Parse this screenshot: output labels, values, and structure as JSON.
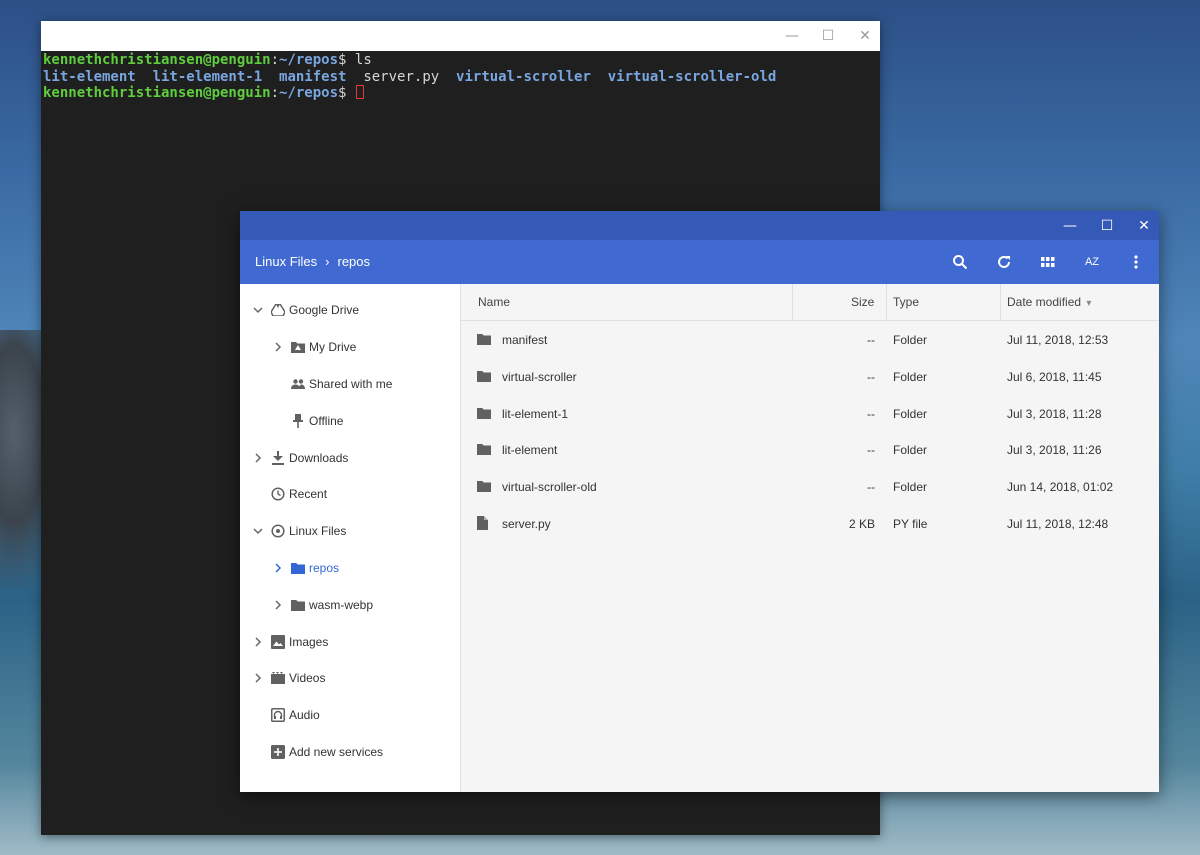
{
  "terminal": {
    "controls": {
      "minimize": "—",
      "maximize": "☐",
      "close": "✕"
    },
    "lines": [
      {
        "user": "kennethchristiansen@penguin",
        "sep": ":",
        "path": "~/repos",
        "prompt": "$ ",
        "cmd": "ls"
      },
      {
        "entries": [
          {
            "name": "lit-element",
            "kind": "dir"
          },
          {
            "name": "lit-element-1",
            "kind": "dir"
          },
          {
            "name": "manifest",
            "kind": "dir"
          },
          {
            "name": "server.py",
            "kind": "file"
          },
          {
            "name": "virtual-scroller",
            "kind": "dir"
          },
          {
            "name": "virtual-scroller-old",
            "kind": "dir"
          }
        ]
      },
      {
        "user": "kennethchristiansen@penguin",
        "sep": ":",
        "path": "~/repos",
        "prompt": "$ ",
        "cmd": ""
      }
    ]
  },
  "files": {
    "controls": {
      "minimize": "—",
      "maximize": "☐",
      "close": "✕"
    },
    "breadcrumb": {
      "root": "Linux Files",
      "separator": "›",
      "current": "repos"
    },
    "toolbar": {
      "search": "search-icon",
      "refresh": "refresh-icon",
      "grid": "grid-view-icon",
      "sort": "sort-az-icon",
      "sort_label": "AZ",
      "more": "more-vert-icon"
    },
    "nav": [
      {
        "label": "Google Drive",
        "icon": "drive-icon",
        "chevron": "down",
        "indent": 0
      },
      {
        "label": "My Drive",
        "icon": "my-drive-icon",
        "chevron": "right",
        "indent": 1
      },
      {
        "label": "Shared with me",
        "icon": "people-icon",
        "chevron": "",
        "indent": 1
      },
      {
        "label": "Offline",
        "icon": "pin-icon",
        "chevron": "",
        "indent": 1
      },
      {
        "label": "Downloads",
        "icon": "download-icon",
        "chevron": "right",
        "indent": 0
      },
      {
        "label": "Recent",
        "icon": "clock-icon",
        "chevron": "",
        "indent": 0
      },
      {
        "label": "Linux Files",
        "icon": "penguin-icon",
        "chevron": "down",
        "indent": 0
      },
      {
        "label": "repos",
        "icon": "folder-icon",
        "chevron": "right",
        "indent": 1,
        "active": true
      },
      {
        "label": "wasm-webp",
        "icon": "folder-icon",
        "chevron": "right",
        "indent": 1
      },
      {
        "label": "Images",
        "icon": "image-icon",
        "chevron": "right",
        "indent": 0
      },
      {
        "label": "Videos",
        "icon": "video-icon",
        "chevron": "right",
        "indent": 0
      },
      {
        "label": "Audio",
        "icon": "audio-icon",
        "chevron": "",
        "indent": 0
      },
      {
        "label": "Add new services",
        "icon": "add-box-icon",
        "chevron": "",
        "indent": 0
      }
    ],
    "columns": {
      "name": "Name",
      "size": "Size",
      "type": "Type",
      "date": "Date modified",
      "sort_indicator": "▾"
    },
    "rows": [
      {
        "name": "manifest",
        "size": "--",
        "type": "Folder",
        "date": "Jul 11, 2018, 12:53",
        "icon": "folder-icon"
      },
      {
        "name": "virtual-scroller",
        "size": "--",
        "type": "Folder",
        "date": "Jul 6, 2018, 11:45",
        "icon": "folder-icon"
      },
      {
        "name": "lit-element-1",
        "size": "--",
        "type": "Folder",
        "date": "Jul 3, 2018, 11:28",
        "icon": "folder-icon"
      },
      {
        "name": "lit-element",
        "size": "--",
        "type": "Folder",
        "date": "Jul 3, 2018, 11:26",
        "icon": "folder-icon"
      },
      {
        "name": "virtual-scroller-old",
        "size": "--",
        "type": "Folder",
        "date": "Jun 14, 2018, 01:02",
        "icon": "folder-icon"
      },
      {
        "name": "server.py",
        "size": "2 KB",
        "type": "PY file",
        "date": "Jul 11, 2018, 12:48",
        "icon": "file-icon"
      }
    ],
    "colors": {
      "titlebar": "#3559b6",
      "header": "#4169d2",
      "accent": "#3367d6"
    }
  }
}
